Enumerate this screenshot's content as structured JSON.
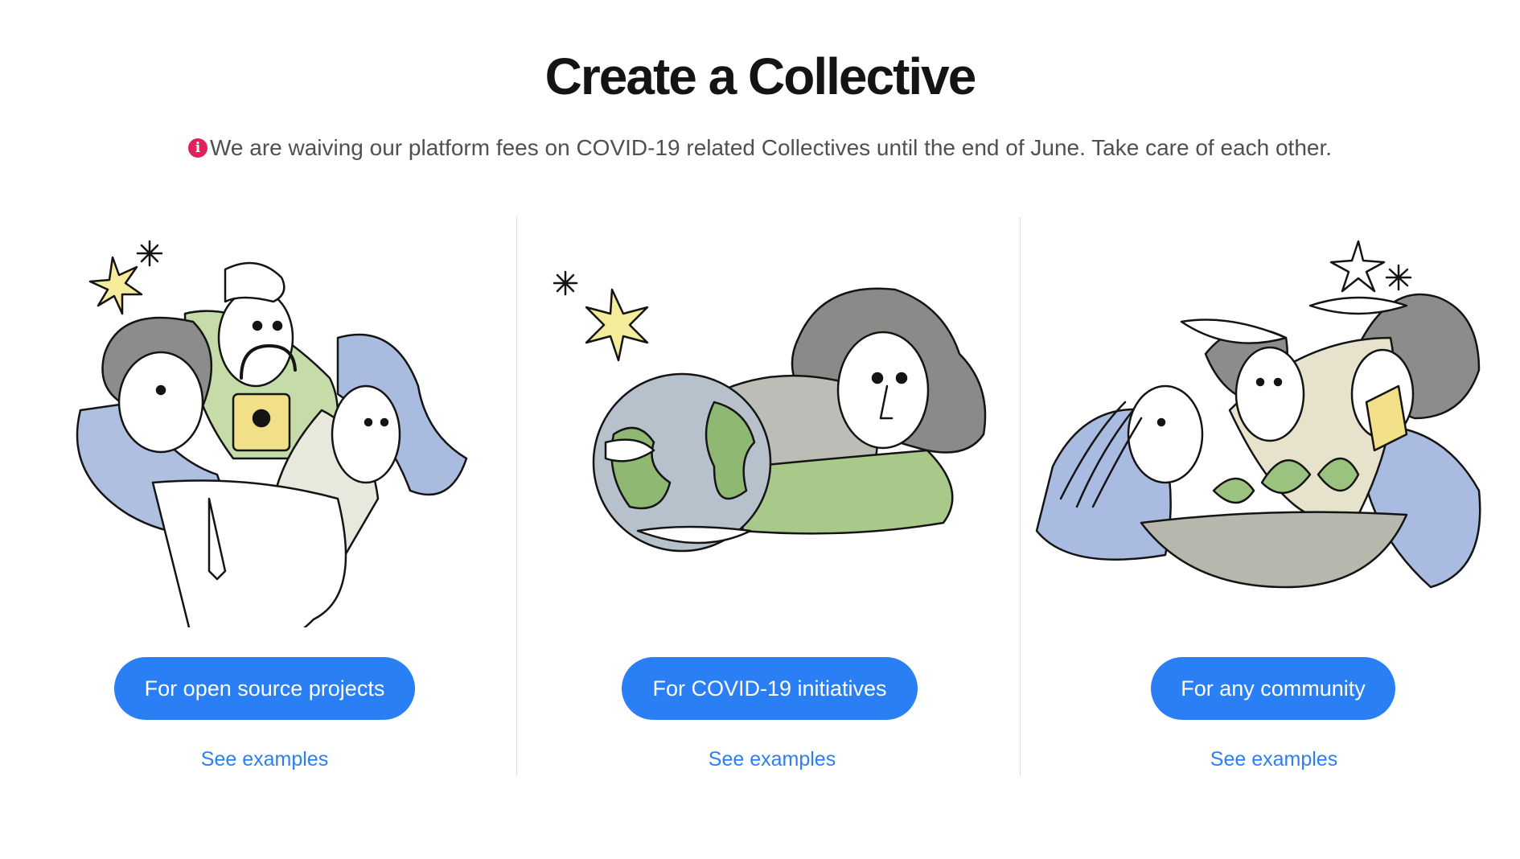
{
  "header": {
    "title": "Create a Collective",
    "notice_icon": "info-icon",
    "notice_icon_glyph": "i",
    "notice_text": "We are waiving our platform fees on COVID-19 related Collectives until the end of June. Take care of each other."
  },
  "colors": {
    "accent": "#2a7ff5",
    "notice_icon": "#e0215e",
    "title": "#141414",
    "notice_text": "#4e5052"
  },
  "options": [
    {
      "button_label": "For open source projects",
      "link_label": "See examples",
      "illustration": "people-with-padlock-illustration"
    },
    {
      "button_label": "For COVID-19 initiatives",
      "link_label": "See examples",
      "illustration": "woman-hugging-globe-illustration"
    },
    {
      "button_label": "For any community",
      "link_label": "See examples",
      "illustration": "people-with-plant-bowl-illustration"
    }
  ]
}
